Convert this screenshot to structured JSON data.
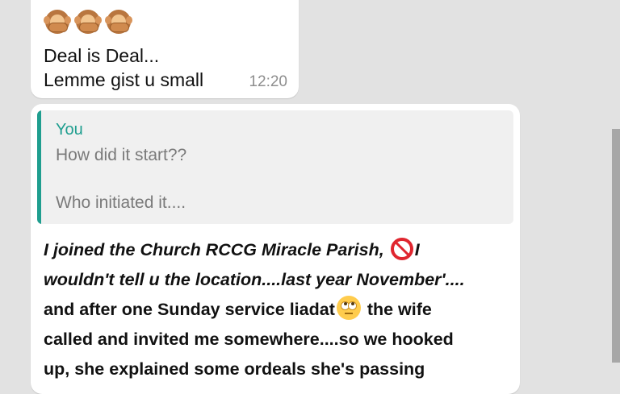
{
  "messages": [
    {
      "emojis": [
        "see-no-evil-monkey",
        "see-no-evil-monkey",
        "see-no-evil-monkey"
      ],
      "lines": [
        "Deal is Deal...",
        "Lemme gist u small"
      ],
      "time": "12:20"
    },
    {
      "quote": {
        "author": "You",
        "lines": [
          "How did it start??",
          "Who initiated it...."
        ]
      },
      "body": {
        "line1_a": "I joined the Church RCCG Miracle Parish, ",
        "line1_b": "I",
        "line2": "wouldn't tell u the location....last year November'....",
        "line3_a": "and after one Sunday service liadat",
        "line3_b": " the wife",
        "line4": "called and invited me somewhere....so we hooked",
        "line5": "up, she explained some ordeals she's passing"
      }
    }
  ],
  "colors": {
    "background": "#e2e2e2",
    "bubble": "#ffffff",
    "accent": "#1f9e8f",
    "timestamp": "#8e8e8e"
  },
  "icons": {
    "prohibited": "prohibited-icon",
    "eye_roll": "face-with-rolling-eyes-icon"
  }
}
